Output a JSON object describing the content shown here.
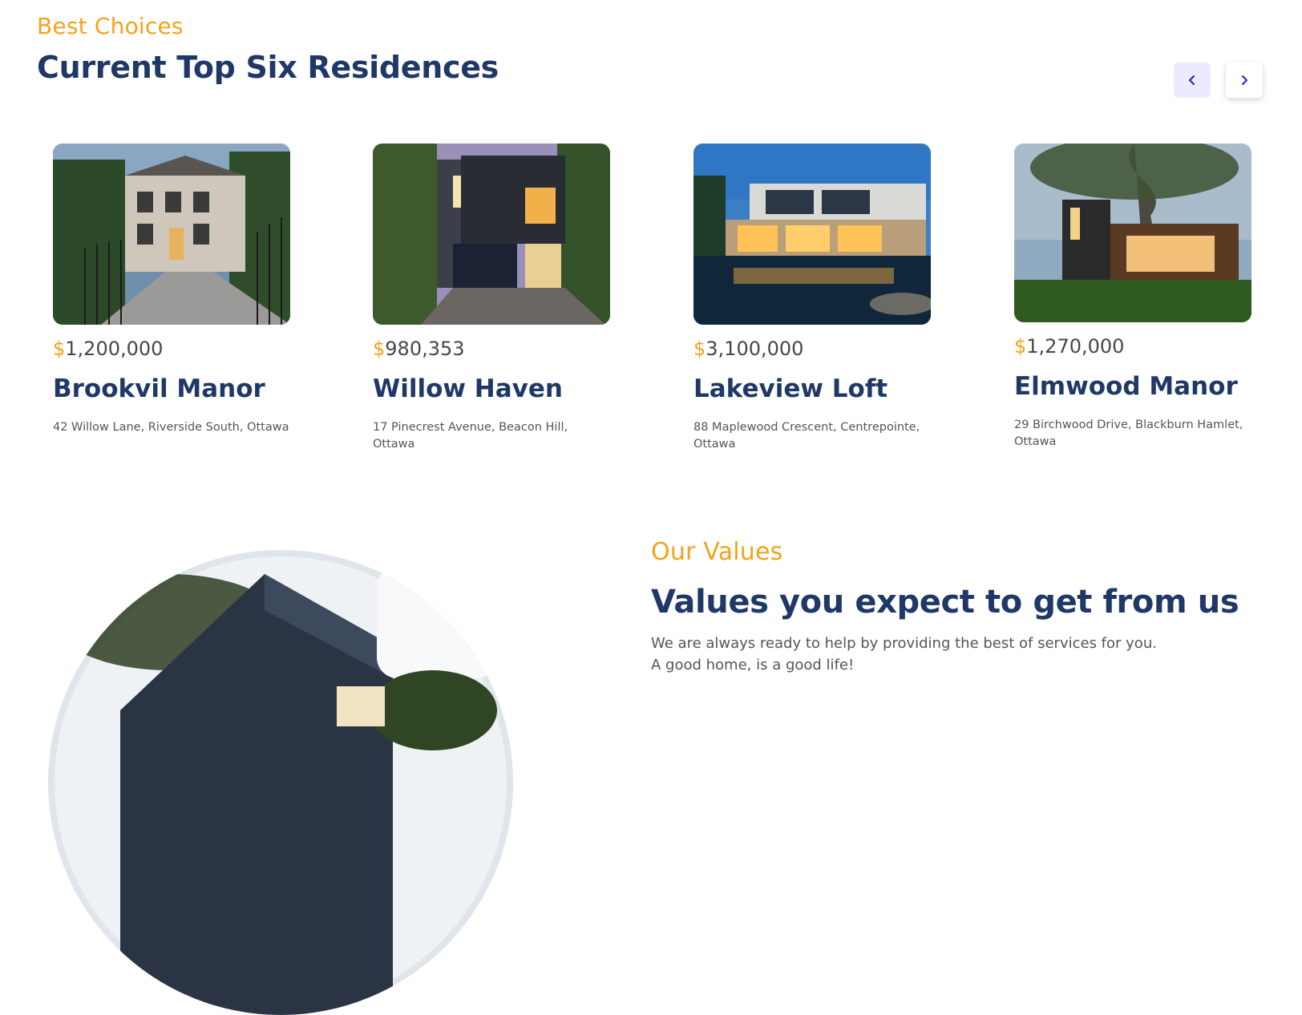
{
  "header": {
    "eyebrow": "Best Choices",
    "title": "Current Top Six Residences"
  },
  "carousel": {
    "prev_icon": "chevron-left-icon",
    "next_icon": "chevron-right-icon"
  },
  "listings": [
    {
      "currency": "$",
      "price": "1,200,000",
      "name": "Brookvil Manor",
      "address": "42 Willow Lane, Riverside South, Ottawa"
    },
    {
      "currency": "$",
      "price": "980,353",
      "name": "Willow Haven",
      "address": "17 Pinecrest Avenue, Beacon Hill, Ottawa"
    },
    {
      "currency": "$",
      "price": "3,100,000",
      "name": "Lakeview Loft",
      "address": "88 Maplewood Crescent, Centrepointe, Ottawa"
    },
    {
      "currency": "$",
      "price": "1,270,000",
      "name": "Elmwood Manor",
      "address": "29 Birchwood Drive, Blackburn Hamlet, Ottawa"
    }
  ],
  "values": {
    "eyebrow": "Our Values",
    "title": "Values you expect to get from us",
    "line1": "We are always ready to help by providing the best of services for you.",
    "line2": "A good home, is a good life!"
  },
  "colors": {
    "accent": "#f7a11a",
    "navy": "#1f3868",
    "button_bg": "#eceaff"
  }
}
